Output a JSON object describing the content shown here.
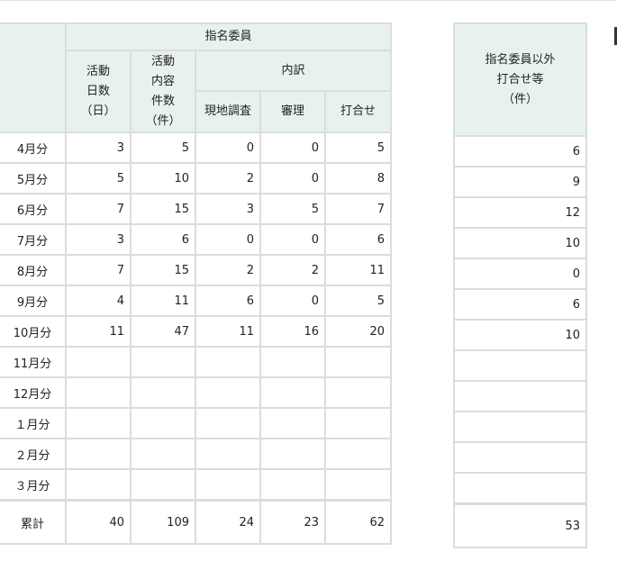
{
  "headers": {
    "designated": "指名委員",
    "activity_days": [
      "活動",
      "日数",
      "（日）"
    ],
    "activity_items": [
      "活動",
      "内容",
      "件数",
      "（件）"
    ],
    "breakdown": "内訳",
    "site_survey": "現地調査",
    "review": "審理",
    "meeting": "打合せ",
    "other": [
      "指名委員以外",
      "打合せ等",
      "（件）"
    ]
  },
  "rows": [
    {
      "month": "4月分",
      "days": "3",
      "items": "5",
      "survey": "0",
      "review": "0",
      "meeting": "5",
      "other": "6"
    },
    {
      "month": "5月分",
      "days": "5",
      "items": "10",
      "survey": "2",
      "review": "0",
      "meeting": "8",
      "other": "9"
    },
    {
      "month": "6月分",
      "days": "7",
      "items": "15",
      "survey": "3",
      "review": "5",
      "meeting": "7",
      "other": "12"
    },
    {
      "month": "7月分",
      "days": "3",
      "items": "6",
      "survey": "0",
      "review": "0",
      "meeting": "6",
      "other": "10"
    },
    {
      "month": "8月分",
      "days": "7",
      "items": "15",
      "survey": "2",
      "review": "2",
      "meeting": "11",
      "other": "0"
    },
    {
      "month": "9月分",
      "days": "4",
      "items": "11",
      "survey": "6",
      "review": "0",
      "meeting": "5",
      "other": "6"
    },
    {
      "month": "10月分",
      "days": "11",
      "items": "47",
      "survey": "11",
      "review": "16",
      "meeting": "20",
      "other": "10"
    },
    {
      "month": "11月分",
      "days": "",
      "items": "",
      "survey": "",
      "review": "",
      "meeting": "",
      "other": ""
    },
    {
      "month": "12月分",
      "days": "",
      "items": "",
      "survey": "",
      "review": "",
      "meeting": "",
      "other": ""
    },
    {
      "month": "１月分",
      "days": "",
      "items": "",
      "survey": "",
      "review": "",
      "meeting": "",
      "other": ""
    },
    {
      "month": "２月分",
      "days": "",
      "items": "",
      "survey": "",
      "review": "",
      "meeting": "",
      "other": ""
    },
    {
      "month": "３月分",
      "days": "",
      "items": "",
      "survey": "",
      "review": "",
      "meeting": "",
      "other": ""
    }
  ],
  "total": {
    "label": "累計",
    "days": "40",
    "items": "109",
    "survey": "24",
    "review": "23",
    "meeting": "62",
    "other": "53"
  }
}
